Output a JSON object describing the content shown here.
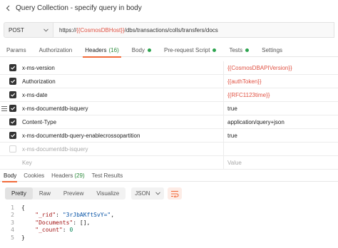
{
  "titlebar": {
    "title": "Query Collection - specify query in body"
  },
  "request": {
    "method": "POST",
    "url_prefix": "https://",
    "url_var": "{{CosmosDBHost}}",
    "url_suffix": "/dbs/transactions/colls/transfers/docs"
  },
  "req_tabs": [
    {
      "label": "Params"
    },
    {
      "label": "Authorization"
    },
    {
      "label": "Headers",
      "count": "(16)"
    },
    {
      "label": "Body"
    },
    {
      "label": "Pre-request Script"
    },
    {
      "label": "Tests"
    },
    {
      "label": "Settings"
    }
  ],
  "headers": [
    {
      "key": "x-ms-version",
      "value": "{{CosmosDBAPIVersion}}"
    },
    {
      "key": "Authorization",
      "value": "{{authToken}}"
    },
    {
      "key": "x-ms-date",
      "value": "{{RFC1123time}}"
    },
    {
      "key": "x-ms-documentdb-isquery",
      "value": "true"
    },
    {
      "key": "Content-Type",
      "value": "application/query+json"
    },
    {
      "key": "x-ms-documentdb-query-enablecrossopartition",
      "value": "true"
    },
    {
      "key": "x-ms-documentdb-isquery",
      "value": ""
    }
  ],
  "header_placeholder": {
    "key": "Key",
    "value": "Value"
  },
  "resp_tabs": [
    {
      "label": "Body"
    },
    {
      "label": "Cookies"
    },
    {
      "label": "Headers",
      "count": "(29)"
    },
    {
      "label": "Test Results"
    }
  ],
  "view_modes": [
    "Pretty",
    "Raw",
    "Preview",
    "Visualize"
  ],
  "format": "JSON",
  "code": {
    "line_numbers": [
      "1",
      "2",
      "3",
      "4",
      "5"
    ],
    "open": "{",
    "rid_key": "\"_rid\"",
    "rid_val": "\"3rJbAKftSvY=\"",
    "docs_key": "\"Documents\"",
    "docs_val": "[]",
    "count_key": "\"_count\"",
    "count_val": "0",
    "close": "}"
  },
  "colors": {
    "accent": "#f26b3a",
    "variable": "#e05243",
    "count": "#2a8a3a"
  },
  "icons": [
    "back-arrow-icon",
    "chevron-down-icon",
    "drag-handle-icon",
    "checkmark-icon",
    "wrap-lines-icon"
  ]
}
